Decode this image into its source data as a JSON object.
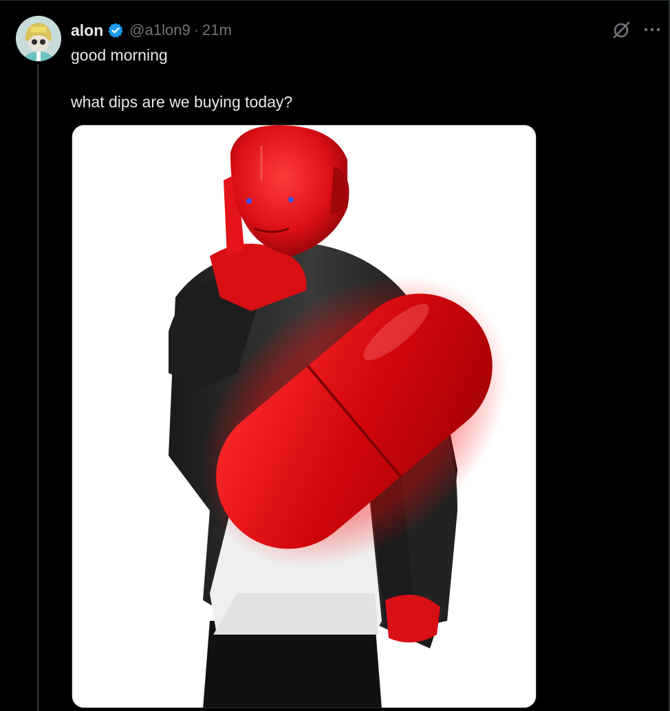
{
  "post": {
    "author_name": "alon",
    "handle": "@a1lon9",
    "separator": "·",
    "timestamp": "21m",
    "text_line1": "good morning",
    "text_line2": "what dips are we buying today?"
  },
  "icons": {
    "verified": "verified-badge-icon",
    "grok": "grok-icon",
    "more": "more-options-icon"
  },
  "colors": {
    "background": "#000000",
    "text_primary": "#e7e9ea",
    "text_secondary": "#71767b",
    "verified_blue": "#1d9bf0",
    "pill_red": "#e0141a"
  }
}
